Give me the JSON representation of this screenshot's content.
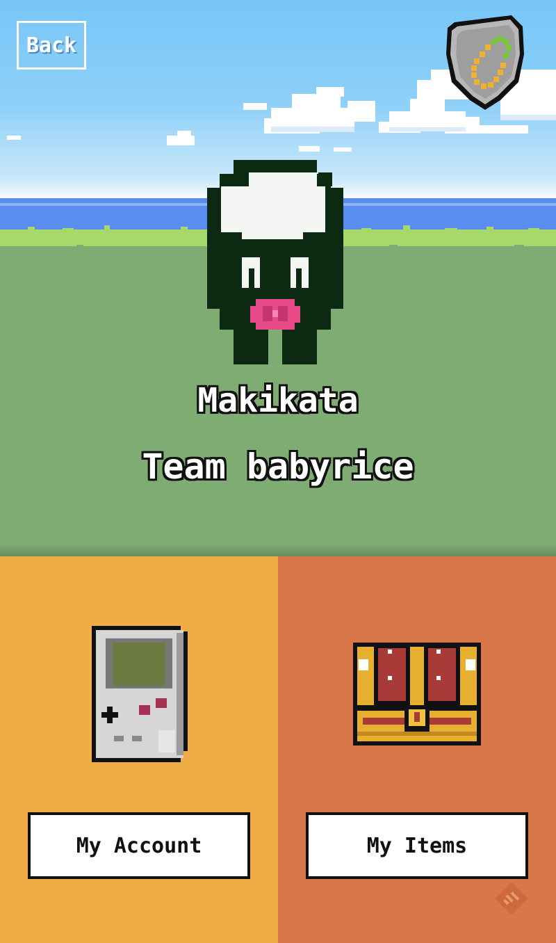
{
  "header": {
    "back_label": "Back"
  },
  "character": {
    "name": "Makikata",
    "team": "Team babyrice"
  },
  "menu": {
    "account": {
      "label": "My Account",
      "icon": "gameboy-icon"
    },
    "items": {
      "label": "My Items",
      "icon": "treasure-chest-icon"
    }
  },
  "icons": {
    "badge": "shield-badge-icon",
    "corner": "feedly-icon"
  },
  "colors": {
    "sky": "#77c6f8",
    "sea": "#5b8df0",
    "grass": "#7fac72",
    "account_panel": "#eeae45",
    "items_panel": "#d87848"
  }
}
